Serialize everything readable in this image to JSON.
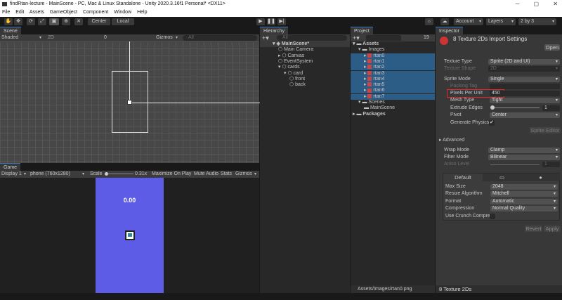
{
  "window": {
    "title": "findRtan-lecture - MainScene - PC, Mac & Linux Standalone - Unity 2020.3.16f1 Personal* <DX11>",
    "minimize": "─",
    "maximize": "▢",
    "close": "✕"
  },
  "menu": [
    "File",
    "Edit",
    "Assets",
    "GameObject",
    "Component",
    "Window",
    "Help"
  ],
  "toolbar": {
    "tools": [
      "✋",
      "✥",
      "⟳",
      "⤢",
      "▣",
      "⊕",
      "✕"
    ],
    "center": "Center",
    "local": "Local",
    "play": "▶",
    "pause": "❚❚",
    "step": "▶|",
    "services": "☼",
    "cloud": "☁",
    "account": "Account",
    "layers": "Layers",
    "layout": "2 by 3"
  },
  "scene": {
    "tab": "Scene",
    "shading": "Shaded",
    "mode_2d": "2D",
    "hidden_count": "0",
    "gizmos": "Gizmos",
    "search_placeholder": "All"
  },
  "game": {
    "tab": "Game",
    "display": "Display 1",
    "resolution": "phone (760x1280)",
    "scale_label": "Scale",
    "scale_value": "0.31x",
    "maximize": "Maximize On Play",
    "mute": "Mute Audio",
    "stats": "Stats",
    "gizmos": "Gizmos",
    "score": "0.00",
    "bg_color": "#5c5ce6"
  },
  "hierarchy": {
    "tab": "Hierarchy",
    "search_placeholder": "All",
    "items": [
      {
        "label": "MainScene*",
        "depth": 0,
        "arrow": "▾",
        "icon": "◈"
      },
      {
        "label": "Main Camera",
        "depth": 1,
        "arrow": "",
        "icon": "⬡"
      },
      {
        "label": "Canvas",
        "depth": 1,
        "arrow": "▸",
        "icon": "⬡"
      },
      {
        "label": "EventSystem",
        "depth": 1,
        "arrow": "",
        "icon": "⬡"
      },
      {
        "label": "cards",
        "depth": 1,
        "arrow": "▾",
        "icon": "⬡"
      },
      {
        "label": "card",
        "depth": 2,
        "arrow": "▾",
        "icon": "⬡"
      },
      {
        "label": "front",
        "depth": 3,
        "arrow": "",
        "icon": "⬡"
      },
      {
        "label": "back",
        "depth": 3,
        "arrow": "",
        "icon": "⬡"
      }
    ]
  },
  "project": {
    "tab": "Project",
    "hidden_count": "19",
    "items": [
      {
        "label": "Assets",
        "depth": 0,
        "arrow": "▾",
        "sel": false
      },
      {
        "label": "Images",
        "depth": 1,
        "arrow": "▾",
        "sel": false
      },
      {
        "label": "rtan0",
        "depth": 2,
        "arrow": "▸",
        "sel": true
      },
      {
        "label": "rtan1",
        "depth": 2,
        "arrow": "▸",
        "sel": true
      },
      {
        "label": "rtan2",
        "depth": 2,
        "arrow": "▸",
        "sel": true
      },
      {
        "label": "rtan3",
        "depth": 2,
        "arrow": "▸",
        "sel": true
      },
      {
        "label": "rtan4",
        "depth": 2,
        "arrow": "▸",
        "sel": true
      },
      {
        "label": "rtan5",
        "depth": 2,
        "arrow": "▸",
        "sel": true
      },
      {
        "label": "rtan6",
        "depth": 2,
        "arrow": "▸",
        "sel": true
      },
      {
        "label": "rtan7",
        "depth": 2,
        "arrow": "▸",
        "sel": true
      },
      {
        "label": "Scenes",
        "depth": 1,
        "arrow": "▾",
        "sel": false
      },
      {
        "label": "MainScene",
        "depth": 2,
        "arrow": "",
        "sel": false
      },
      {
        "label": "Packages",
        "depth": 0,
        "arrow": "▸",
        "sel": false
      }
    ],
    "path": "Assets/Images/rtan0.png"
  },
  "inspector": {
    "tab": "Inspector",
    "title": "8 Texture 2Ds Import Settings",
    "open": "Open",
    "texture_type_label": "Texture Type",
    "texture_type": "Sprite (2D and UI)",
    "texture_shape_label": "Texture Shape",
    "texture_shape": "2D",
    "sprite_mode_label": "Sprite Mode",
    "sprite_mode": "Single",
    "packing_tag_label": "Packing Tag",
    "ppu_label": "Pixels Per Unit",
    "ppu": "450",
    "mesh_type_label": "Mesh Type",
    "mesh_type": "Tight",
    "extrude_label": "Extrude Edges",
    "extrude": "1",
    "pivot_label": "Pivot",
    "pivot": "Center",
    "physics_label": "Generate Physics",
    "physics_check": "✔",
    "sprite_editor": "Sprite Editor",
    "advanced": "Advanced",
    "wrap_label": "Wrap Mode",
    "wrap": "Clamp",
    "filter_label": "Filter Mode",
    "filter": "Bilinear",
    "aniso_label": "Aniso Level",
    "aniso": "1",
    "platform_default": "Default",
    "max_size_label": "Max Size",
    "max_size": "2048",
    "resize_label": "Resize Algorithm",
    "resize": "Mitchell",
    "format_label": "Format",
    "format": "Automatic",
    "compression_label": "Compression",
    "compression": "Normal Quality",
    "crunch_label": "Use Crunch Compres",
    "revert": "Revert",
    "apply": "Apply",
    "footer": "8 Texture 2Ds"
  }
}
